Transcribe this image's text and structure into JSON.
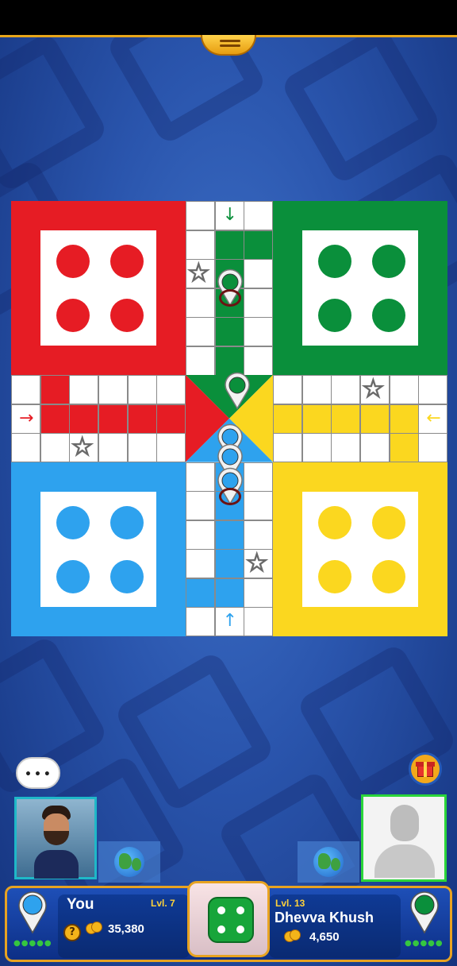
{
  "player_you": {
    "name": "You",
    "level": "Lvl. 7",
    "coins": "35,380",
    "help_symbol": "?",
    "avatar_icon": "male-avatar-icon",
    "color": "#2ea2ee"
  },
  "player_opponent": {
    "name": "Dhevva Khush",
    "level": "Lvl. 13",
    "coins": "4,650",
    "avatar_icon": "default-avatar-icon",
    "color": "#0a8f3b"
  },
  "chat": {
    "text": "•••",
    "icon": "chat-bubble-icon"
  },
  "dice": {
    "value": 4,
    "color": "#17a53a"
  },
  "board": {
    "colors": {
      "red": "#e61c24",
      "green": "#0a8f3b",
      "yellow": "#fbd71f",
      "blue": "#2ea2ee"
    },
    "arrows": {
      "top": "↓",
      "left": "→",
      "right": "←",
      "bottom": "↑"
    },
    "star_symbol": "☆"
  },
  "icons": {
    "gift": "gift-icon",
    "globe": "globe-icon",
    "menu": "menu-tab-icon",
    "coin": "coins-icon",
    "pawn": "pawn-icon"
  }
}
